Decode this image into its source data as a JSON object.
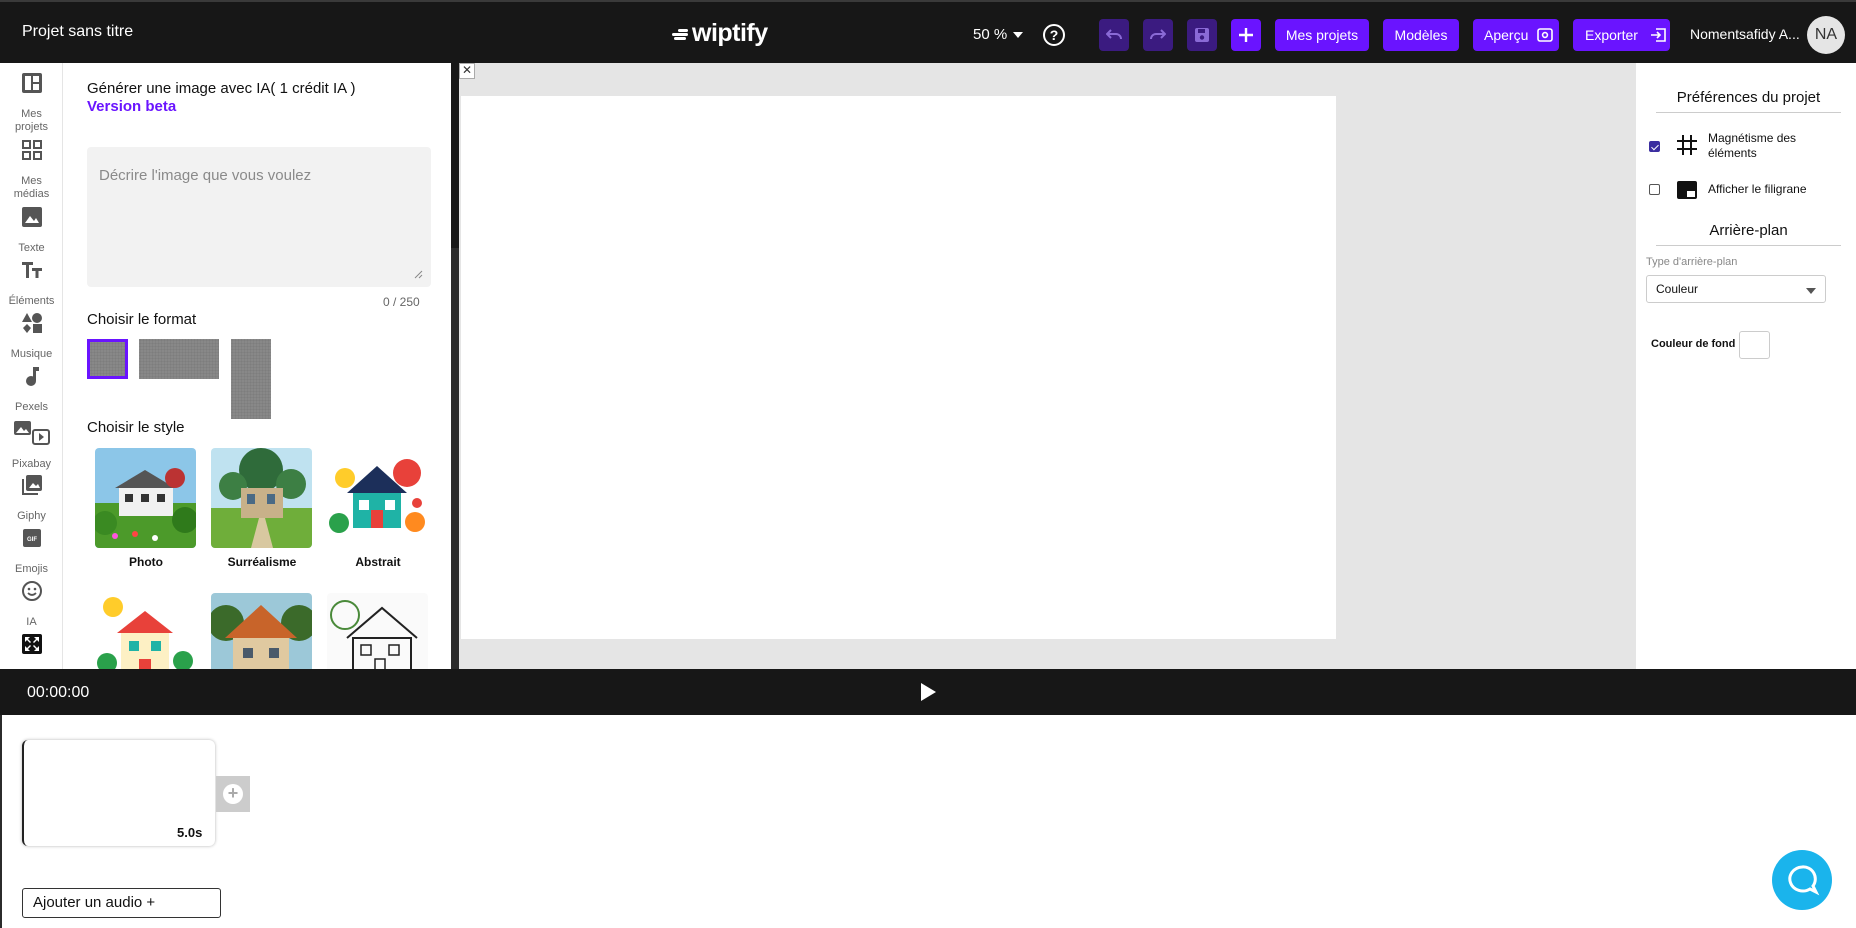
{
  "header": {
    "project_title": "Projet sans titre",
    "logo_text": "wiptify",
    "zoom": "50 %",
    "help_label": "?",
    "my_projects_label": "Mes projets",
    "templates_label": "Modèles",
    "preview_label": "Aperçu",
    "export_label": "Exporter",
    "user_name": "Nomentsafidy A...",
    "user_initials": "NA",
    "accent_color": "#6a14ff"
  },
  "rail": {
    "items": [
      {
        "label_1": "Mes",
        "label_2": "projets",
        "icon": "dashboard-icon"
      },
      {
        "label_1": "Mes",
        "label_2": "médias",
        "icon": "grid-icon"
      },
      {
        "label_1": "Texte",
        "icon": "image-icon"
      },
      {
        "label_1": "Éléments",
        "icon": "text-icon"
      },
      {
        "label_1": "Musique",
        "icon": "shapes-icon"
      },
      {
        "label_1": "Pexels",
        "icon": "music-icon"
      },
      {
        "label_1": "Pixabay",
        "icon": "media-icon"
      },
      {
        "label_1": "Giphy",
        "icon": "photo-library-icon"
      },
      {
        "label_1": "Emojis",
        "icon": "gif-icon"
      },
      {
        "label_1": "IA",
        "icon": "smiley-icon"
      }
    ],
    "active_icon": "ai-icon"
  },
  "ai_panel": {
    "heading": "Générer une image avec IA( 1 crédit IA )",
    "beta": "Version beta",
    "prompt_placeholder": "Décrire l'image que vous voulez",
    "counter": "0 / 250",
    "format_title": "Choisir le format",
    "style_title": "Choisir le style",
    "styles": [
      {
        "label": "Photo"
      },
      {
        "label": "Surréalisme"
      },
      {
        "label": "Abstrait"
      }
    ]
  },
  "right_panel": {
    "prefs_title": "Préférences du projet",
    "magnet_label_1": "Magnétisme des",
    "magnet_label_2": "éléments",
    "magnet_checked": true,
    "watermark_label": "Afficher le filigrane",
    "watermark_checked": false,
    "background_title": "Arrière-plan",
    "background_type_label": "Type d'arrière-plan",
    "background_type_value": "Couleur",
    "background_color_label": "Couleur de fond",
    "background_color": "#ffffff"
  },
  "player": {
    "time": "00:00:00"
  },
  "timeline": {
    "clip_duration": "5.0s",
    "add_audio_label": "Ajouter un audio +"
  }
}
